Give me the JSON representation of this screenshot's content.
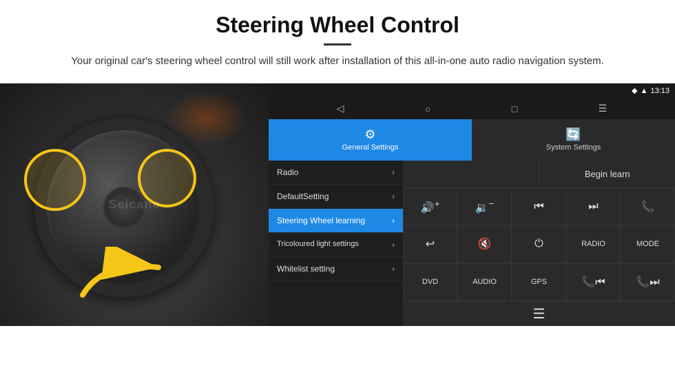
{
  "header": {
    "title": "Steering Wheel Control",
    "subtitle": "Your original car's steering wheel control will still work after installation of this all-in-one auto radio navigation system."
  },
  "status_bar": {
    "icons": "♦ ▲",
    "time": "13:13"
  },
  "tabs": [
    {
      "id": "general",
      "label": "General Settings",
      "icon": "⚙",
      "active": true
    },
    {
      "id": "system",
      "label": "System Settings",
      "icon": "🔄",
      "active": false
    }
  ],
  "menu_items": [
    {
      "id": "radio",
      "label": "Radio",
      "active": false
    },
    {
      "id": "default",
      "label": "DefaultSetting",
      "active": false
    },
    {
      "id": "steering",
      "label": "Steering Wheel learning",
      "active": true
    },
    {
      "id": "tricoloured",
      "label": "Tricoloured light settings",
      "active": false
    },
    {
      "id": "whitelist",
      "label": "Whitelist setting",
      "active": false
    }
  ],
  "controls": {
    "begin_learn": "Begin learn",
    "buttons": [
      {
        "id": "vol-up",
        "icon": "🔊+",
        "text": ""
      },
      {
        "id": "vol-down",
        "icon": "🔉−",
        "text": ""
      },
      {
        "id": "prev",
        "icon": "⏮",
        "text": ""
      },
      {
        "id": "next",
        "icon": "⏭",
        "text": ""
      },
      {
        "id": "phone",
        "icon": "📞",
        "text": ""
      },
      {
        "id": "hang-up",
        "icon": "📵",
        "text": ""
      },
      {
        "id": "mute",
        "icon": "🔇",
        "text": ""
      },
      {
        "id": "power",
        "icon": "⏻",
        "text": ""
      },
      {
        "id": "radio-btn",
        "icon": "",
        "text": "RADIO"
      },
      {
        "id": "mode",
        "icon": "",
        "text": "MODE"
      },
      {
        "id": "dvd",
        "icon": "",
        "text": "DVD"
      },
      {
        "id": "audio",
        "icon": "",
        "text": "AUDIO"
      },
      {
        "id": "gps",
        "icon": "",
        "text": "GPS"
      },
      {
        "id": "tel-prev",
        "icon": "📞⏮",
        "text": ""
      },
      {
        "id": "tel-next",
        "icon": "📞⏭",
        "text": ""
      }
    ],
    "bottom_icon": "≡"
  }
}
